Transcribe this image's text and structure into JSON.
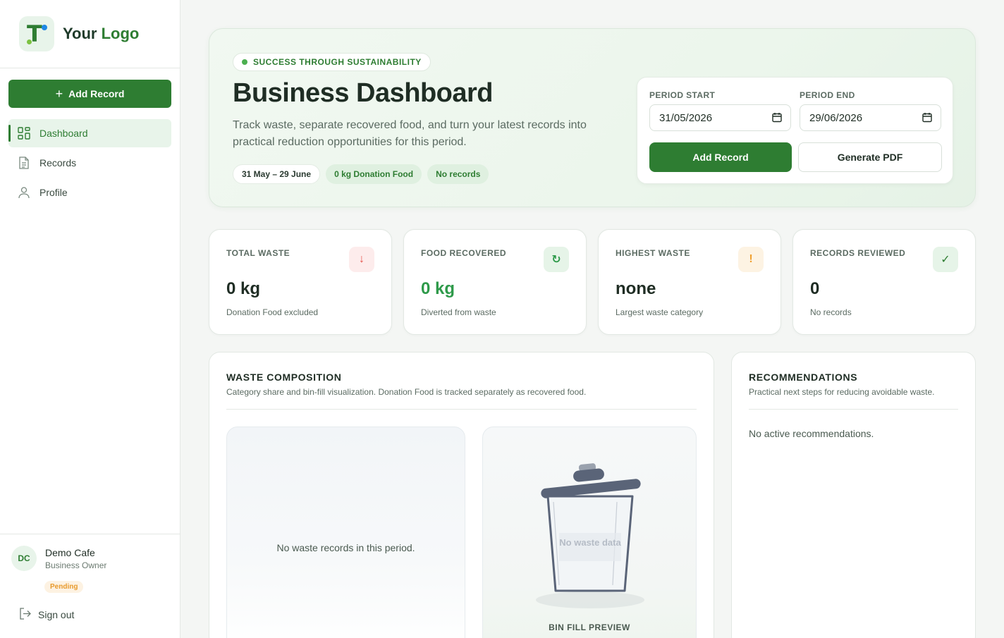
{
  "brand": {
    "text_main": "Your",
    "text_accent": "Logo"
  },
  "sidebar": {
    "add_label": "Add Record",
    "items": [
      {
        "label": "Dashboard",
        "icon": "dashboard-icon",
        "active": true
      },
      {
        "label": "Records",
        "icon": "document-icon",
        "active": false
      },
      {
        "label": "Profile",
        "icon": "user-icon",
        "active": false
      }
    ],
    "user": {
      "initials": "DC",
      "name": "Demo Cafe",
      "role": "Business Owner",
      "status": "Pending"
    },
    "signout_label": "Sign out"
  },
  "hero": {
    "badge": "SUCCESS THROUGH SUSTAINABILITY",
    "title": "Business Dashboard",
    "description": "Track waste, separate recovered food, and turn your latest records into practical reduction opportunities for this period.",
    "tags": [
      "31 May – 29 June",
      "0 kg Donation Food",
      "No records"
    ]
  },
  "period": {
    "start_label": "PERIOD START",
    "start_value": "31/05/2026",
    "end_label": "PERIOD END",
    "end_value": "29/06/2026",
    "add_label": "Add Record",
    "pdf_label": "Generate PDF"
  },
  "stats": [
    {
      "label": "TOTAL WASTE",
      "value": "0 kg",
      "sub": "Donation Food excluded",
      "icon": "arrow-down-icon",
      "icon_glyph": "↓",
      "color": "#e5534b",
      "bg": "#fdecec"
    },
    {
      "label": "FOOD RECOVERED",
      "value": "0 kg",
      "sub": "Diverted from waste",
      "icon": "refresh-icon",
      "icon_glyph": "↻",
      "color": "#2e9a4a",
      "bg": "#e6f4e8"
    },
    {
      "label": "HIGHEST WASTE",
      "value": "none",
      "sub": "Largest waste category",
      "icon": "warning-icon",
      "icon_glyph": "!",
      "color": "#f0a030",
      "bg": "#fdf3e3"
    },
    {
      "label": "RECORDS REVIEWED",
      "value": "0",
      "sub": "No records",
      "icon": "check-icon",
      "icon_glyph": "✓",
      "color": "#2e7d32",
      "bg": "#e6f4e8"
    }
  ],
  "composition": {
    "title": "WASTE COMPOSITION",
    "subtitle": "Category share and bin-fill visualization. Donation Food is tracked separately as recovered food.",
    "empty": "No waste records in this period.",
    "bin_empty": "No waste data",
    "bin_label": "BIN FILL PREVIEW"
  },
  "recommendations": {
    "title": "RECOMMENDATIONS",
    "subtitle": "Practical next steps for reducing avoidable waste.",
    "empty": "No active recommendations."
  }
}
